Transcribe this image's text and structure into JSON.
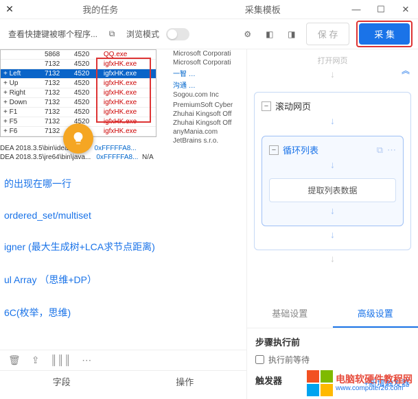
{
  "titlebar": {
    "tabs": [
      "我的任务",
      "采集模板"
    ]
  },
  "toolbar": {
    "url_text": "查看快捷键被哪个程序...",
    "preview_label": "浏览模式",
    "save_label": "保 存",
    "collect_label": "采 集"
  },
  "table": {
    "rows": [
      {
        "c0": "",
        "c1": "5868",
        "c2": "4520",
        "c3": "QQ.exe"
      },
      {
        "c0": "",
        "c1": "7132",
        "c2": "4520",
        "c3": "igfxHK.exe"
      },
      {
        "c0": "+ Left",
        "c1": "7132",
        "c2": "4520",
        "c3": "igfxHK.exe",
        "sel": true
      },
      {
        "c0": "+ Up",
        "c1": "7132",
        "c2": "4520",
        "c3": "igfxHK.exe"
      },
      {
        "c0": "+ Right",
        "c1": "7132",
        "c2": "4520",
        "c3": "igfxHK.exe"
      },
      {
        "c0": "+ Down",
        "c1": "7132",
        "c2": "4520",
        "c3": "igfxHK.exe"
      },
      {
        "c0": "+ F1",
        "c1": "7132",
        "c2": "4520",
        "c3": "igfxHK.exe"
      },
      {
        "c0": "+ F5",
        "c1": "7132",
        "c2": "4520",
        "c3": "igfxHK.exe"
      },
      {
        "c0": "+ F6",
        "c1": "7132",
        "c2": "4520",
        "c3": "igfxHK.exe"
      }
    ]
  },
  "idea": [
    {
      "path": "DEA 2018.3.5\\bin\\idea64.exe",
      "hex": "0xFFFFFA8...",
      "na": ""
    },
    {
      "path": "DEA 2018.3.5\\jre64\\bin\\java...",
      "hex": "0xFFFFFA8...",
      "na": "N/A"
    }
  ],
  "procs": [
    "Microsoft Corporati",
    "Microsoft Corporati",
    "一智 …",
    "沟通 …",
    "Sogou.com Inc",
    "",
    "PremiumSoft Cyber",
    "Zhuhai Kingsoft Off",
    "Zhuhai Kingsoft Off",
    "anyMania.com",
    "JetBrains s.r.o."
  ],
  "links": [
    "的出现在哪一行",
    "ordered_set/multiset",
    "igner (最大生成树+LCA求节点距离)",
    "ul Array  （思维+DP）",
    "6C(枚举，思维)"
  ],
  "bottom": {
    "fields_label": "字段",
    "ops_label": "操作"
  },
  "flow": {
    "top_label": "打开网页",
    "scroll_label": "滚动网页",
    "loop_label": "循环列表",
    "extract_label": "提取列表数据"
  },
  "tabs": {
    "basic": "基础设置",
    "advanced": "高级设置"
  },
  "settings": {
    "before_title": "步骤执行前",
    "wait_label": "执行前等待",
    "trigger_title": "触发器",
    "add_trigger": "+新增触发器"
  },
  "watermark": {
    "line1": "电脑软硬件教程网",
    "line2": "www.computer26.com"
  }
}
